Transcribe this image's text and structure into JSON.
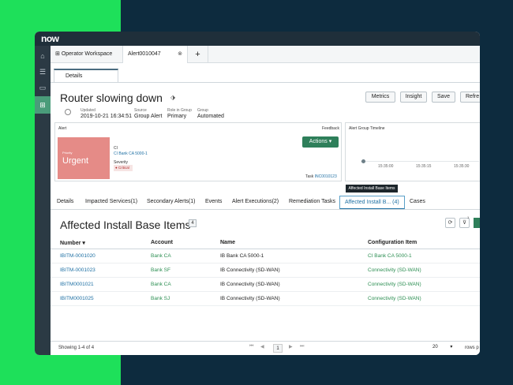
{
  "brand": {
    "logo": "now",
    "green": "#1ee05a",
    "navy": "#0d2b3e",
    "accent": "#2e7f5a",
    "link": "#1d6fa3"
  },
  "workspace_tabs": {
    "workspace": "Operator Workspace",
    "record": "Alert0010047",
    "close_icon": "⊗",
    "add_icon": "+"
  },
  "subtab": "Details",
  "record": {
    "title": "Router slowing down"
  },
  "buttons": {
    "metrics": "Metrics",
    "insight": "Insight",
    "save": "Save",
    "refresh": "Refre"
  },
  "meta": [
    {
      "label": "Updated",
      "value": "2019-10-21 16:34:51"
    },
    {
      "label": "Source",
      "value": "Group Alert"
    },
    {
      "label": "Role in Group",
      "value": "Primary"
    },
    {
      "label": "Group",
      "value": "Automated"
    }
  ],
  "alert_card": {
    "header": "Alert",
    "feedback": "Feedback",
    "priority_label": "Priority",
    "priority_value": "Urgent",
    "ci_label": "CI",
    "ci_value": "CI Bank CA 5000-1",
    "severity_label": "Severity",
    "severity_value": "Critical",
    "actions": "Actions",
    "task_label": "Task",
    "task_value": "INC0010123"
  },
  "timeline": {
    "header": "Alert Group Timeline",
    "ticks": [
      "15:35:00",
      "15:35:15",
      "15:35:30"
    ]
  },
  "tooltip": "Affected Install Base Items",
  "record_tabs": [
    "Details",
    "Impacted Services(1)",
    "Secondary Alerts(1)",
    "Events",
    "Alert Executions(2)",
    "Remediation Tasks",
    "Affected Install B... (4)",
    "Cases"
  ],
  "list": {
    "title": "Affected Install Base Items",
    "count": "4",
    "filter_badge": "1",
    "columns": [
      "Number",
      "Account",
      "Name",
      "Configuration Item"
    ],
    "sort_indicator": "▾",
    "rows": [
      [
        "IBITM-0001020",
        "Bank CA",
        "IB Bank CA 5000-1",
        "CI Bank CA 5000-1"
      ],
      [
        "IBITM-0001023",
        "Bank SF",
        "IB Connectivity (SD-WAN)",
        "Connectivity (SD-WAN)"
      ],
      [
        "IBITM0001021",
        "Bank CA",
        "IB Connectivity (SD-WAN)",
        "Connectivity (SD-WAN)"
      ],
      [
        "IBITM0001025",
        "Bank SJ",
        "IB Connectivity (SD-WAN)",
        "Connectivity (SD-WAN)"
      ]
    ]
  },
  "footer": {
    "showing": "Showing 1-4 of 4",
    "page": "1",
    "rows": "20",
    "rows_label": "rows p"
  }
}
